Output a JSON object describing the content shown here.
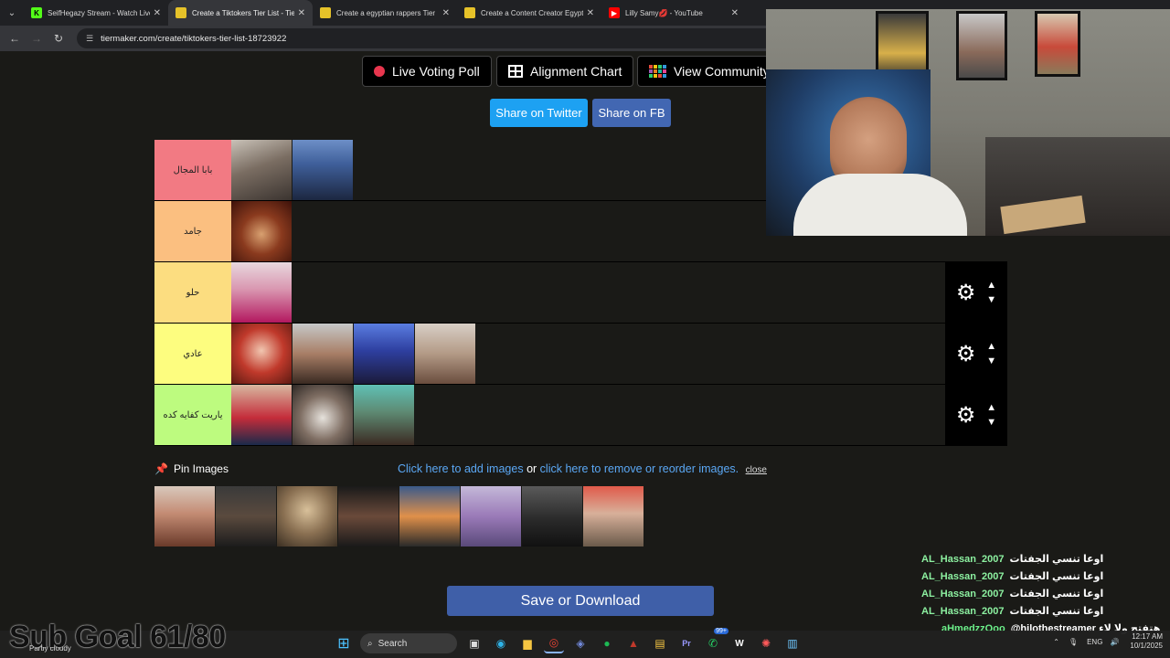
{
  "tabs": [
    {
      "title": "SeifHegazy Stream - Watch Live",
      "favicon": "kick-icon",
      "color": "#53fc18",
      "active": false
    },
    {
      "title": "Create a Tiktokers Tier List - Tie",
      "favicon": "tiermaker-icon",
      "color": "#e6c229",
      "active": true
    },
    {
      "title": "Create a egyptian rappers Tier",
      "favicon": "tiermaker-icon",
      "color": "#e6c229",
      "active": false
    },
    {
      "title": "Create a Content Creator Egypt",
      "favicon": "tiermaker-icon",
      "color": "#e6c229",
      "active": false
    },
    {
      "title": "Lilly Samy💋 - YouTube",
      "favicon": "youtube-icon",
      "color": "#ff0000",
      "active": false
    }
  ],
  "address": {
    "url": "tiermaker.com/create/tiktokers-tier-list-18723922"
  },
  "toolbar": {
    "live_voting": "Live Voting Poll",
    "alignment_chart": "Alignment Chart",
    "view_community": "View Community R"
  },
  "share": {
    "twitter": "Share on Twitter",
    "fb": "Share on FB",
    "twitter_color": "#1da1f2",
    "fb_color": "#4267b2"
  },
  "tiers": [
    {
      "label": "بابا المجال",
      "color": "#f27a83",
      "count": 2
    },
    {
      "label": "جامد",
      "color": "#fbbf80",
      "count": 1
    },
    {
      "label": "حلو",
      "color": "#fcdd80",
      "count": 1
    },
    {
      "label": "عادي",
      "color": "#fdfd7f",
      "count": 4
    },
    {
      "label": "ياريت كفايه كده",
      "color": "#bdfb7f",
      "count": 3
    }
  ],
  "pin": {
    "label": "Pin Images"
  },
  "links": {
    "add": "Click here to add images",
    "or": "or",
    "remove": "click here to remove or reorder images.",
    "close": "close"
  },
  "save": {
    "label": "Save or Download"
  },
  "chat": [
    {
      "user": "AL_Hassan_2007",
      "msg": "اوعا تنسي الجفتات"
    },
    {
      "user": "AL_Hassan_2007",
      "msg": "اوعا تنسي الجفتات"
    },
    {
      "user": "AL_Hassan_2007",
      "msg": "اوعا تنسي الجفتات"
    },
    {
      "user": "AL_Hassan_2007",
      "msg": "اوعا تنسي الجفتات"
    },
    {
      "user": "aHmedzzOoo",
      "msg": "@hilothestreamer هتفتح ولا لاء"
    }
  ],
  "overlay": {
    "subgoal": "Sub Goal 61/80"
  },
  "taskbar": {
    "search": "Search",
    "lang": "ENG",
    "time": "12:17 AM",
    "date": "10/1/2025",
    "weather": "Partly cloudy",
    "badge": "99+"
  }
}
